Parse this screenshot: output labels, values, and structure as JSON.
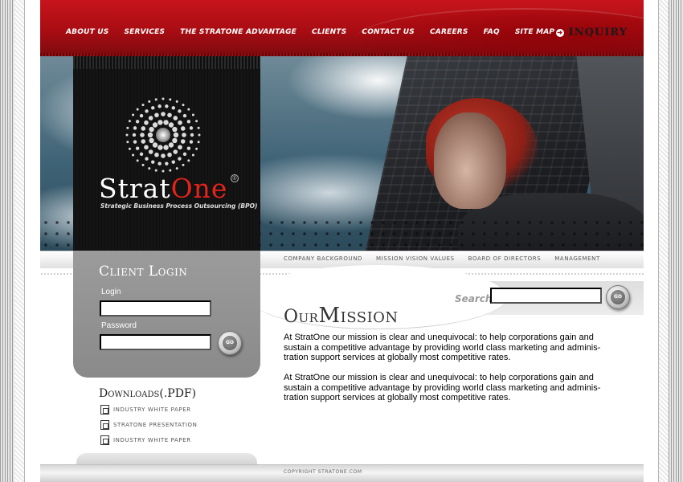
{
  "nav": {
    "items": [
      {
        "label": "ABOUT US"
      },
      {
        "label": "SERVICES"
      },
      {
        "label": "THE STRATONE ADVANTAGE"
      },
      {
        "label": "CLIENTS"
      },
      {
        "label": "CONTACT US"
      },
      {
        "label": "CAREERS"
      },
      {
        "label": "FAQ"
      },
      {
        "label": "SITE MAP"
      }
    ],
    "inquiry_label": "INQUIRY"
  },
  "brand": {
    "name_part1": "Strat",
    "name_part2": "One",
    "registered": "®",
    "tagline": "Strategic Business Process Outsourcing (BPO)"
  },
  "login": {
    "title": "Client Login",
    "login_label": "Login",
    "login_value": "",
    "password_label": "Password",
    "password_value": "",
    "go_label": "GO"
  },
  "subnav": {
    "items": [
      {
        "label": "COMPANY BACKGROUND"
      },
      {
        "label": "MISSION VISION VALUES"
      },
      {
        "label": "BOARD OF DIRECTORS"
      },
      {
        "label": "MANAGEMENT"
      }
    ]
  },
  "search": {
    "label": "Search",
    "value": "",
    "go_label": "GO"
  },
  "mission": {
    "title_small": "Our",
    "title_big": "Mission",
    "paragraphs": [
      "At StratOne our mission is clear and unequivocal: to help corporations gain and sustain a competitive advantage by providing world class marketing and adminis-tration support services at globally most competitive rates.",
      "At StratOne our mission is clear and unequivocal: to help corporations gain and sustain a competitive advantage by providing world class marketing and adminis-tration support services at globally most competitive rates."
    ]
  },
  "downloads": {
    "title": "Downloads(.PDF)",
    "items": [
      {
        "label": "INDUSTRY WHITE PAPER"
      },
      {
        "label": "STRATONE PRESENTATION"
      },
      {
        "label": "INDUSTRY WHITE PAPER"
      }
    ]
  },
  "footer": {
    "copyright": "COPYRIGHT STRATONE.COM"
  },
  "colors": {
    "header_red": "#b3121a",
    "brand_red": "#e5231b",
    "panel_dark": "#141414",
    "panel_grey": "#8f8f8f"
  },
  "icons": {
    "inquiry": "arrow-circle-right-icon",
    "logo": "starburst-logo-icon",
    "download": "pdf-document-icon"
  }
}
